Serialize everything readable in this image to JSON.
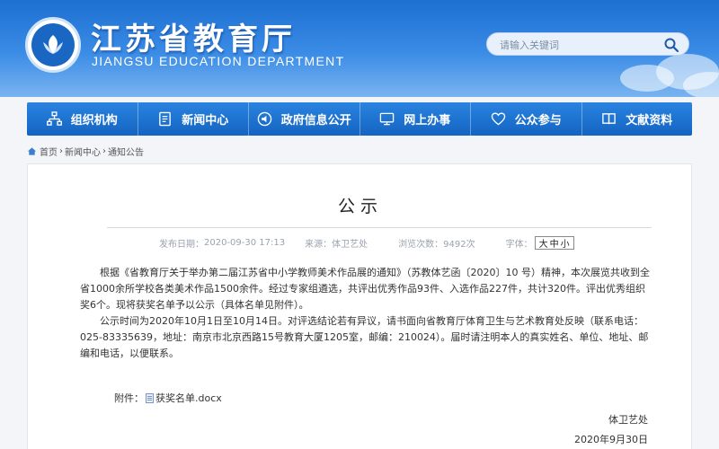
{
  "header": {
    "title_cn": "江苏省教育厅",
    "title_en": "JIANGSU EDUCATION DEPARTMENT",
    "logo_icon": "education-department-emblem",
    "search": {
      "placeholder": "请输入关键词",
      "icon": "search-icon"
    }
  },
  "nav": {
    "items": [
      {
        "label": "组织机构",
        "icon": "org-chart-icon"
      },
      {
        "label": "新闻中心",
        "icon": "news-document-icon"
      },
      {
        "label": "政府信息公开",
        "icon": "speaker-icon"
      },
      {
        "label": "网上办事",
        "icon": "monitor-icon"
      },
      {
        "label": "公众参与",
        "icon": "heart-icon"
      },
      {
        "label": "文献资料",
        "icon": "book-icon"
      }
    ]
  },
  "breadcrumb": [
    "首页",
    "新闻中心",
    "通知公告"
  ],
  "article": {
    "title": "公示",
    "meta": {
      "date_label": "发布日期：",
      "date": "2020-09-30 17:13",
      "source_label": "来源：",
      "source": "体卫艺处",
      "views_label": "浏览次数：",
      "views": "9492次",
      "font_label": "字体：",
      "font_big": "大",
      "font_mid": "中",
      "font_small": "小"
    },
    "paragraphs": [
      "根据《省教育厅关于举办第二届江苏省中小学教师美术作品展的通知》（苏教体艺函〔2020〕10 号）精神，本次展览共收到全省1000余所学校各类美术作品1500余件。经过专家组遴选，共评出优秀作品93件、入选作品227件，共计320件。评出优秀组织奖6个。现将获奖名单予以公示（具体名单见附件）。",
      "公示时间为2020年10月1日至10月14日。对评选结论若有异议，请书面向省教育厅体育卫生与艺术教育处反映（联系电话：025-83335639，地址：南京市北京西路15号教育大厦1205室，邮编：210024）。届时请注明本人的真实姓名、单位、地址、邮编和电话，以便联系。"
    ],
    "attachment_label": "附件：",
    "attachment_file": "获奖名单.docx",
    "signature_dept": "体卫艺处",
    "signature_date": "2020年9月30日"
  },
  "colors": {
    "header_blue": "#1d6fd1",
    "nav_blue": "#1464c2",
    "page_bg": "#f3f5f8"
  }
}
